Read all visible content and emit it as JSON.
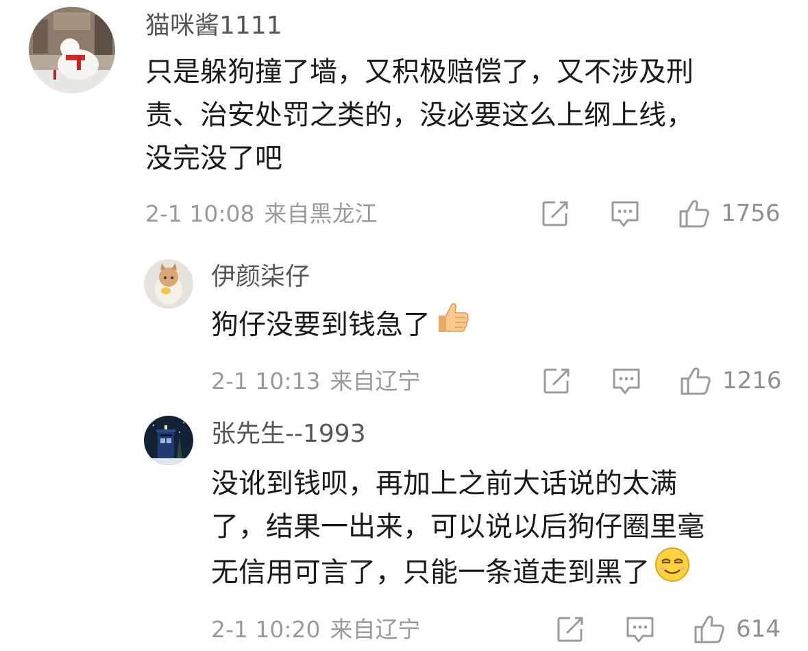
{
  "comments": [
    {
      "username": "猫咪酱1111",
      "lines": [
        "只是躲狗撞了墙，又积极赔偿了，又不涉及刑",
        "责、治安处罚之类的，没必要这么上纲上线，",
        "没完没了吧"
      ],
      "time": "2-1 10:08",
      "location": "来自黑龙江",
      "likes": "1756",
      "avatar_icon": "polar-bear-snow-sculpture"
    },
    {
      "username": "伊颜柒仔",
      "lines": [
        "狗仔没要到钱急了"
      ],
      "emoji": "thumbs-up-emoji",
      "time": "2-1 10:13",
      "location": "来自辽宁",
      "likes": "1216",
      "avatar_icon": "kitten-photo"
    },
    {
      "username": "张先生--1993",
      "lines": [
        "没讹到钱呗，再加上之前大话说的太满",
        "了，结果一出来，可以说以后狗仔圈里毫",
        "无信用可言了，只能一条道走到黑了"
      ],
      "emoji": "smug-face-emoji",
      "time": "2-1 10:20",
      "location": "来自辽宁",
      "likes": "614",
      "avatar_icon": "police-box-night"
    }
  ],
  "icons": {
    "share": "edit-share-icon",
    "reply": "comment-bubble-icon",
    "like": "thumbs-up-icon"
  },
  "colors": {
    "username": "#555555",
    "content": "#1a1a1a",
    "meta": "#9a9a9a",
    "icon": "#9a9a9a"
  }
}
